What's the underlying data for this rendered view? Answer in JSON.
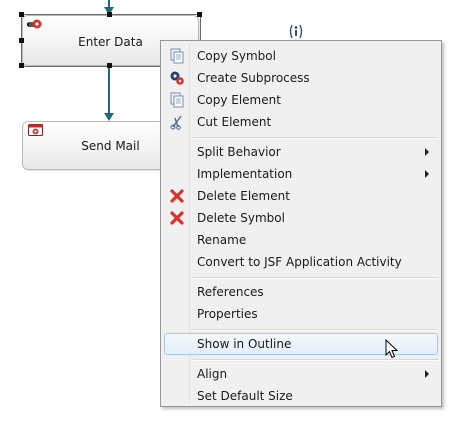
{
  "diagram": {
    "activities": [
      {
        "label": "Enter Data",
        "icon": "interactive-activity-icon"
      },
      {
        "label": "Send Mail",
        "icon": "mail-activity-icon"
      }
    ],
    "floating_icon": "info-marker-icon"
  },
  "context_menu": {
    "groups": [
      [
        {
          "label": "Copy Symbol",
          "icon": "copy-symbol-icon",
          "submenu": false
        },
        {
          "label": "Create Subprocess",
          "icon": "gears-icon",
          "submenu": false
        },
        {
          "label": "Copy Element",
          "icon": "copy-element-icon",
          "submenu": false
        },
        {
          "label": "Cut Element",
          "icon": "scissors-icon",
          "submenu": false
        }
      ],
      [
        {
          "label": "Split Behavior",
          "icon": "",
          "submenu": true
        },
        {
          "label": "Implementation",
          "icon": "",
          "submenu": true
        },
        {
          "label": "Delete Element",
          "icon": "red-x-icon",
          "submenu": false
        },
        {
          "label": "Delete Symbol",
          "icon": "red-x-icon",
          "submenu": false
        },
        {
          "label": "Rename",
          "icon": "",
          "submenu": false
        },
        {
          "label": "Convert to JSF Application Activity",
          "icon": "",
          "submenu": false
        }
      ],
      [
        {
          "label": "References",
          "icon": "",
          "submenu": false
        },
        {
          "label": "Properties",
          "icon": "",
          "submenu": false
        }
      ],
      [
        {
          "label": "Show in Outline",
          "icon": "",
          "submenu": false,
          "highlighted": true
        }
      ],
      [
        {
          "label": "Align",
          "icon": "",
          "submenu": true
        },
        {
          "label": "Set Default Size",
          "icon": "",
          "submenu": false
        }
      ]
    ]
  },
  "colors": {
    "connector": "#1e6a7a",
    "menu_background": "#f0f0f0",
    "highlight_border": "#a8c8ea",
    "delete_red": "#d9312b"
  }
}
